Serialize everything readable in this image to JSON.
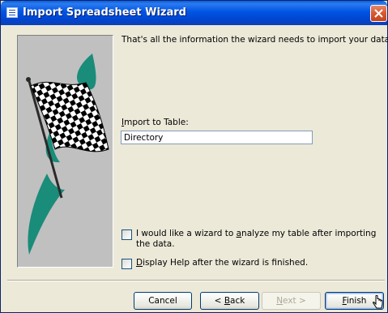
{
  "window": {
    "title": "Import Spreadsheet Wizard",
    "icon": "form-icon"
  },
  "main": {
    "message": "That's all the information the wizard needs to import your data.",
    "import_label_underlined": "I",
    "import_label_rest": "mport to Table:",
    "table_value": "Directory",
    "analyze_option": {
      "pre": "I would like a wizard to ",
      "underlined": "a",
      "post": "nalyze my table after importing the data.",
      "checked": false
    },
    "help_option": {
      "underlined": "D",
      "post": "isplay Help after the wizard is finished.",
      "checked": false
    }
  },
  "buttons": {
    "cancel": "Cancel",
    "back_prefix": "< ",
    "back_underlined": "B",
    "back_rest": "ack",
    "next_underlined": "N",
    "next_rest": "ext >",
    "finish_underlined": "F",
    "finish_rest": "inish"
  },
  "colors": {
    "titlebar": "#0054e3",
    "close_button": "#d9582f",
    "panel_background": "#c0c0c0",
    "swoosh": "#1a8c7a",
    "dialog_background": "#ece9d8"
  },
  "illustration": {
    "icon": "checkered-flag-icon"
  }
}
